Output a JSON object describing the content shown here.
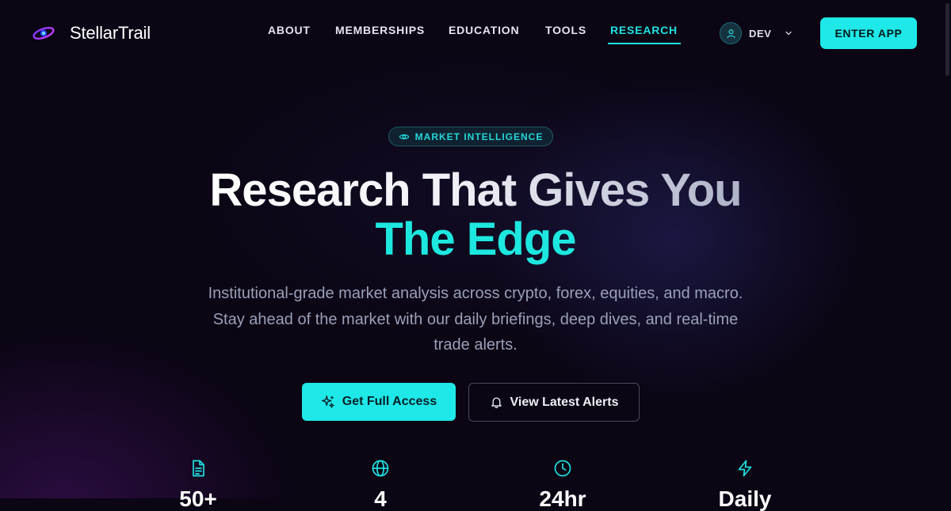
{
  "brand": {
    "name": "StellarTrail",
    "logo_icon": "orbit-planet-icon"
  },
  "nav": {
    "items": [
      {
        "label": "ABOUT"
      },
      {
        "label": "MEMBERSHIPS"
      },
      {
        "label": "EDUCATION"
      },
      {
        "label": "TOOLS"
      },
      {
        "label": "RESEARCH",
        "active": true
      }
    ]
  },
  "user": {
    "name": "DEV",
    "icon": "user-icon",
    "dropdown_icon": "chevron-down-icon"
  },
  "header": {
    "enter_app_label": "ENTER APP"
  },
  "hero": {
    "badge": {
      "icon": "eye-icon",
      "label": "MARKET INTELLIGENCE"
    },
    "title_line1": "Research That Gives You",
    "title_line2": "The Edge",
    "description": "Institutional-grade market analysis across crypto, forex, equities, and macro. Stay ahead of the market with our daily briefings, deep dives, and real-time trade alerts.",
    "primary_cta": {
      "label": "Get Full Access",
      "icon": "sparkles-icon"
    },
    "secondary_cta": {
      "label": "View Latest Alerts",
      "icon": "bell-icon"
    }
  },
  "stats": [
    {
      "icon": "document-icon",
      "value": "50+"
    },
    {
      "icon": "globe-icon",
      "value": "4"
    },
    {
      "icon": "clock-icon",
      "value": "24hr"
    },
    {
      "icon": "lightning-icon",
      "value": "Daily"
    }
  ],
  "colors": {
    "background": "#0b0514",
    "accent": "#1fe8e8",
    "text": "#ffffff",
    "muted_text": "#9aa0b8"
  }
}
